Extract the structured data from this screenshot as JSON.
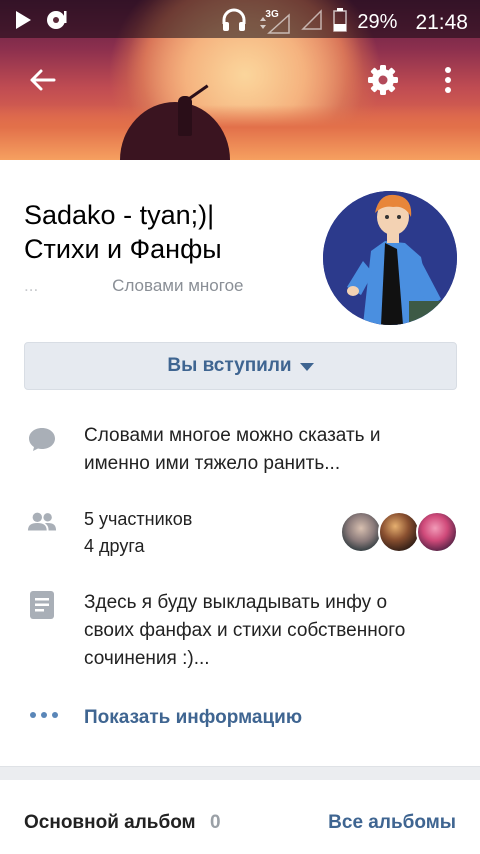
{
  "status_bar": {
    "network": "3G",
    "battery": "29%",
    "time": "21:48"
  },
  "community": {
    "title_line1": "Sadako - tyan;)|",
    "title_line2": "Стихи и Фанфы",
    "status_dots": "...",
    "status_text": "Словами многое",
    "join_button": "Вы вступили"
  },
  "info": {
    "status": "Словами многое можно сказать и именно ими тяжело ранить...",
    "members_count": "5 участников",
    "friends_count": "4 друга",
    "description": "Здесь я буду выкладывать инфу о своих фанфах и стихи собственного сочинения :)...",
    "show_info": "Показать информацию"
  },
  "albums": {
    "title": "Основной альбом",
    "count": "0",
    "all_link": "Все альбомы"
  },
  "colors": {
    "accent": "#3f6591",
    "join_bg": "#e6eaf0",
    "icon_gray": "#a9afb7"
  },
  "icons": [
    "play-icon",
    "headphones-icon",
    "signal-icon",
    "battery-icon",
    "back-arrow-icon",
    "gear-icon",
    "more-vertical-icon",
    "comment-icon",
    "members-icon",
    "document-icon",
    "dots-icon"
  ]
}
